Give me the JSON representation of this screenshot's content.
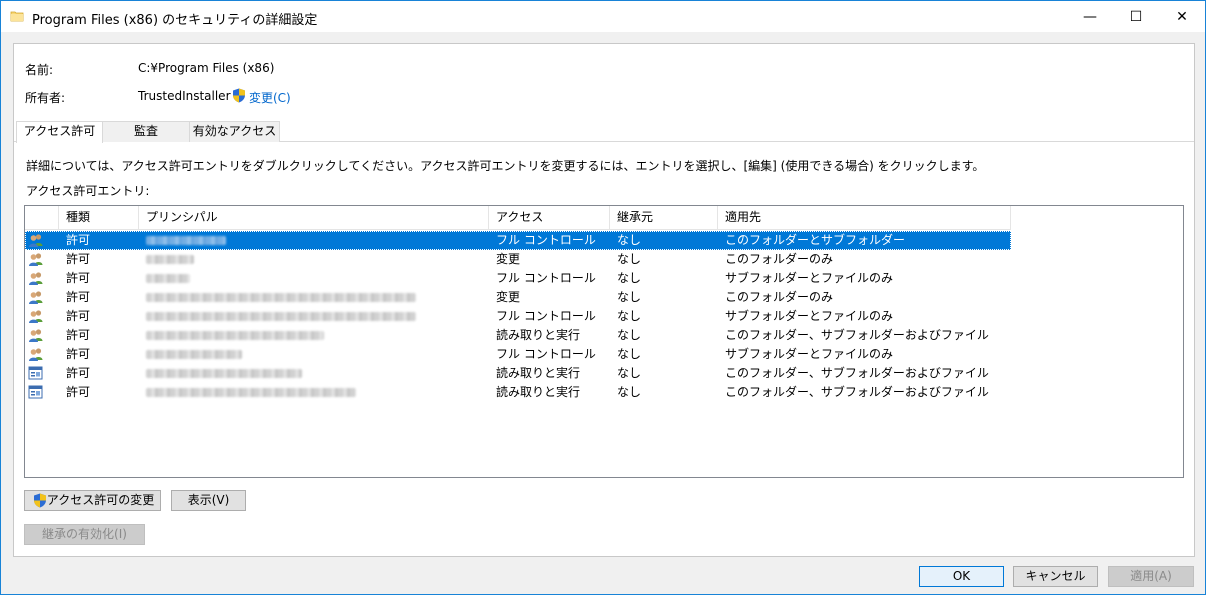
{
  "window": {
    "title": "Program Files (x86) のセキュリティの詳細設定",
    "min_glyph": "—",
    "max_glyph": "☐",
    "close_glyph": "✕"
  },
  "info": {
    "name_label": "名前:",
    "name_value": "C:¥Program Files (x86)",
    "owner_label": "所有者:",
    "owner_value": "TrustedInstaller",
    "owner_change": "変更(C)"
  },
  "tabs": [
    {
      "label": "アクセス許可"
    },
    {
      "label": "監査"
    },
    {
      "label": "有効なアクセス"
    }
  ],
  "description": "詳細については、アクセス許可エントリをダブルクリックしてください。アクセス許可エントリを変更するには、エントリを選択し、[編集] (使用できる場合) をクリックします。",
  "entries_label": "アクセス許可エントリ:",
  "table": {
    "headers": [
      "種類",
      "プリンシパル",
      "アクセス",
      "継承元",
      "適用先"
    ],
    "rows": [
      {
        "type": "許可",
        "access": "フル コントロール",
        "inherit": "なし",
        "applies": "このフォルダーとサブフォルダー",
        "icon": "users-icon"
      },
      {
        "type": "許可",
        "access": "変更",
        "inherit": "なし",
        "applies": "このフォルダーのみ",
        "icon": "users-icon"
      },
      {
        "type": "許可",
        "access": "フル コントロール",
        "inherit": "なし",
        "applies": "サブフォルダーとファイルのみ",
        "icon": "users-icon"
      },
      {
        "type": "許可",
        "access": "変更",
        "inherit": "なし",
        "applies": "このフォルダーのみ",
        "icon": "users-icon"
      },
      {
        "type": "許可",
        "access": "フル コントロール",
        "inherit": "なし",
        "applies": "サブフォルダーとファイルのみ",
        "icon": "users-icon"
      },
      {
        "type": "許可",
        "access": "読み取りと実行",
        "inherit": "なし",
        "applies": "このフォルダー、サブフォルダーおよびファイル",
        "icon": "users-icon"
      },
      {
        "type": "許可",
        "access": "フル コントロール",
        "inherit": "なし",
        "applies": "サブフォルダーとファイルのみ",
        "icon": "users-icon"
      },
      {
        "type": "許可",
        "access": "読み取りと実行",
        "inherit": "なし",
        "applies": "このフォルダー、サブフォルダーおよびファイル",
        "icon": "app-package-icon"
      },
      {
        "type": "許可",
        "access": "読み取りと実行",
        "inherit": "なし",
        "applies": "このフォルダー、サブフォルダーおよびファイル",
        "icon": "app-package-icon"
      }
    ]
  },
  "buttons": {
    "change_permissions": "アクセス許可の変更",
    "view": "表示(V)",
    "enable_inheritance": "継承の有効化(I)",
    "ok": "OK",
    "cancel": "キャンセル",
    "apply": "適用(A)"
  },
  "colors": {
    "accent": "#0078d7",
    "window_border": "#1883d7"
  }
}
